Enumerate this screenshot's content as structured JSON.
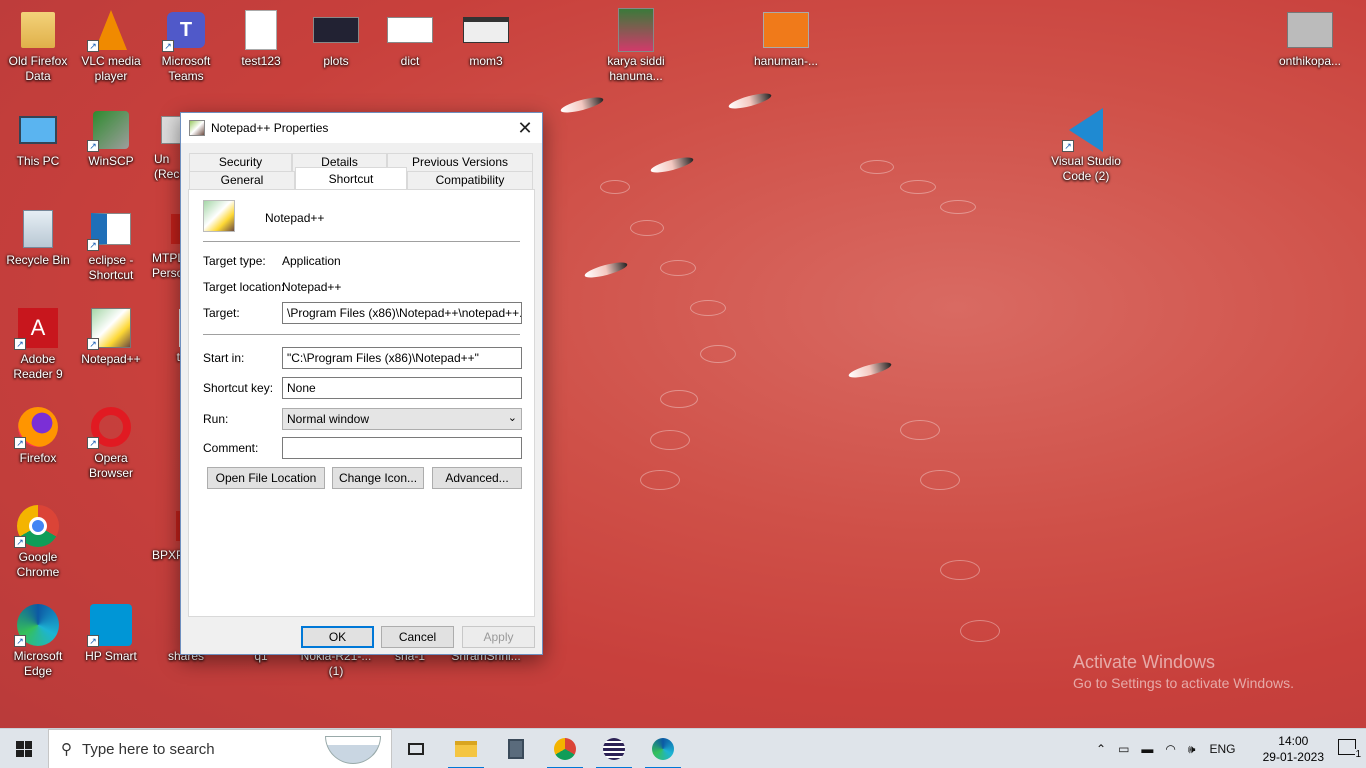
{
  "desktop": {
    "icons": [
      {
        "label": "Old Firefox\nData"
      },
      {
        "label": "VLC media\nplayer"
      },
      {
        "label": "Microsoft\nTeams"
      },
      {
        "label": "test123"
      },
      {
        "label": "plots"
      },
      {
        "label": "dict"
      },
      {
        "label": "mom3"
      },
      {
        "label": "karya siddi\nhanuma..."
      },
      {
        "label": "hanuman-..."
      },
      {
        "label": "onthikopa..."
      },
      {
        "label": "This PC"
      },
      {
        "label": "WinSCP"
      },
      {
        "label": "Un\n(Reco"
      },
      {
        "label": "Visual Studio\nCode (2)"
      },
      {
        "label": "Recycle Bin"
      },
      {
        "label": "eclipse -\nShortcut"
      },
      {
        "label": "MTPL\nPerso"
      },
      {
        "label": "Adobe\nReader 9"
      },
      {
        "label": "Notepad++"
      },
      {
        "label": "t"
      },
      {
        "label": "Firefox"
      },
      {
        "label": "Opera\nBrowser"
      },
      {
        "label": "Google\nChrome"
      },
      {
        "label": "BPXP"
      },
      {
        "label": "Microsoft\nEdge"
      },
      {
        "label": "HP Smart"
      },
      {
        "label": "shares"
      },
      {
        "label": "q1"
      },
      {
        "label": "Nokia-R21-...\n(1)"
      },
      {
        "label": "sha-1"
      },
      {
        "label": "SriramSrini..."
      }
    ]
  },
  "dialog": {
    "title": "Notepad++ Properties",
    "tabs_row1": [
      "Security",
      "Details",
      "Previous Versions"
    ],
    "tabs_row2": [
      "General",
      "Shortcut",
      "Compatibility"
    ],
    "active_tab": "Shortcut",
    "app_name": "Notepad++",
    "target_type_label": "Target type:",
    "target_type_value": "Application",
    "target_location_label": "Target location:",
    "target_location_value": "Notepad++",
    "target_label": "Target:",
    "target_value": "\\Program Files (x86)\\Notepad++\\notepad++.exe\"",
    "start_in_label": "Start in:",
    "start_in_value": "\"C:\\Program Files (x86)\\Notepad++\"",
    "shortcut_key_label": "Shortcut key:",
    "shortcut_key_value": "None",
    "run_label": "Run:",
    "run_value": "Normal window",
    "comment_label": "Comment:",
    "comment_value": "",
    "open_file_location": "Open File Location",
    "change_icon": "Change Icon...",
    "advanced": "Advanced...",
    "ok": "OK",
    "cancel": "Cancel",
    "apply": "Apply"
  },
  "watermark": {
    "line1": "Activate Windows",
    "line2": "Go to Settings to activate Windows."
  },
  "taskbar": {
    "search_placeholder": "Type here to search",
    "apps": [
      "task-view",
      "file-explorer",
      "calculator",
      "chrome",
      "eclipse",
      "edge"
    ],
    "language": "ENG",
    "time": "14:00",
    "date": "29-01-2023",
    "notification_count": "1"
  },
  "colors": {
    "accent": "#0078d7",
    "wallpaper": "#c8403c"
  }
}
